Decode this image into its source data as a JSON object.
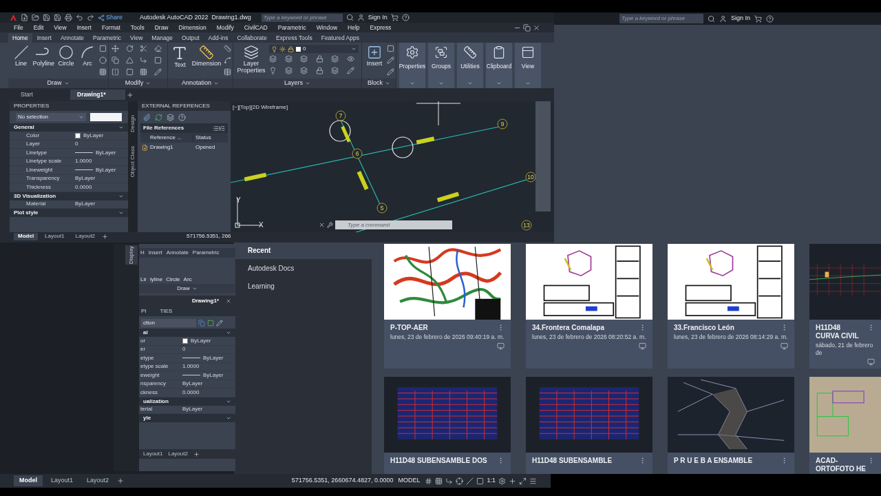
{
  "back_window": {
    "search": {
      "placeholder": "Type a keyword or phrase"
    },
    "sign_in": "Sign In",
    "nav": [
      {
        "label": "Recent",
        "selected": true
      },
      {
        "label": "Autodesk Docs",
        "selected": false
      },
      {
        "label": "Learning",
        "selected": false
      }
    ],
    "files": [
      {
        "name": "P-TOP-AER",
        "date": "lunes, 23 de febrero de 2026 09:40:19 a. m.",
        "kind": "map"
      },
      {
        "name": "34.Frontera Comalapa",
        "date": "lunes, 23 de febrero de 2026 08:20:52 a. m.",
        "kind": "plan"
      },
      {
        "name": "33.Francisco León",
        "date": "lunes, 23 de febrero de 2026 08:14:29 a. m.",
        "kind": "plan"
      },
      {
        "name": "H11D48 CURVA CIVIL",
        "date": "sábado, 21 de febrero de",
        "kind": "profile"
      },
      {
        "name": "H11D48 SUBENSAMBLE DOS",
        "kind": "table"
      },
      {
        "name": "H11D48 SUBENSAMBLE",
        "kind": "table"
      },
      {
        "name": "P R U E B A ENSAMBLE",
        "kind": "mesh"
      },
      {
        "name": "ACAD-ORTOFOTO HE",
        "kind": "aerial"
      }
    ],
    "status_bar": {
      "layout_tabs": [
        {
          "label": "Model",
          "selected": true
        },
        {
          "label": "Layout1",
          "selected": false
        },
        {
          "label": "Layout2",
          "selected": false
        }
      ],
      "coordinates": "571756.5351, 2660674.4827, 0.0000",
      "space": "MODEL",
      "scale": "1:1"
    }
  },
  "ghost_window": {
    "side_tab": "Display",
    "tabs": [
      "H",
      "Insert",
      "Annotate",
      "Parametric"
    ],
    "tools": [
      "Lir",
      "lyline",
      "Circle",
      "Arc"
    ],
    "panel": "Draw",
    "doc_tab": "Drawing1*",
    "palette_title": [
      "PI",
      "TIES"
    ],
    "selection": "ction",
    "sections": [
      {
        "title": "al",
        "rows": [
          {
            "name": "or",
            "value": "ByLayer",
            "kind": "color"
          },
          {
            "name": "er",
            "value": "0",
            "kind": "plain"
          },
          {
            "name": "etype",
            "value": "ByLayer",
            "kind": "line"
          },
          {
            "name": "etype scale",
            "value": "1.0000",
            "kind": "plain"
          },
          {
            "name": "eweight",
            "value": "ByLayer",
            "kind": "line"
          },
          {
            "name": "nsparency",
            "value": "ByLayer",
            "kind": "plain"
          },
          {
            "name": "ckness",
            "value": "0.0000",
            "kind": "plain"
          }
        ]
      },
      {
        "title": "ualization",
        "rows": [
          {
            "name": "terial",
            "value": "ByLayer",
            "kind": "plain"
          }
        ]
      },
      {
        "title": "yle"
      }
    ],
    "layout_tabs": [
      "Layout1",
      "Layout2"
    ]
  },
  "app_window": {
    "title": "Autodesk AutoCAD 2022",
    "file_name": "Drawing1.dwg",
    "share": "Share",
    "search": {
      "placeholder": "Type a keyword or phrase"
    },
    "sign_in": "Sign In",
    "menu": [
      "File",
      "Edit",
      "View",
      "Insert",
      "Format",
      "Tools",
      "Draw",
      "Dimension",
      "Modify",
      "CivilCAD",
      "Parametric",
      "Window",
      "Help",
      "Express"
    ],
    "ribbon_tabs": [
      {
        "label": "Home",
        "selected": true
      },
      {
        "label": "Insert",
        "selected": false
      },
      {
        "label": "Annotate",
        "selected": false
      },
      {
        "label": "Parametric",
        "selected": false
      },
      {
        "label": "View",
        "selected": false
      },
      {
        "label": "Manage",
        "selected": false
      },
      {
        "label": "Output",
        "selected": false
      },
      {
        "label": "Add-ins",
        "selected": false
      },
      {
        "label": "Collaborate",
        "selected": false
      },
      {
        "label": "Express Tools",
        "selected": false
      },
      {
        "label": "Featured Apps",
        "selected": false
      }
    ],
    "panels": [
      {
        "title": "Draw",
        "kind": "draw",
        "tools": [
          "Line",
          "Polyline",
          "Circle",
          "Arc"
        ]
      },
      {
        "title": "Modify",
        "kind": "modify"
      },
      {
        "title": "Annotation",
        "kind": "annotation",
        "tools": [
          "Text",
          "Dimension"
        ]
      },
      {
        "title": "Layers",
        "kind": "layers",
        "tools": [
          "Layer Properties"
        ],
        "layer": "0"
      },
      {
        "title": "Block",
        "kind": "block",
        "tools": [
          "Insert"
        ]
      }
    ],
    "collapsed_panels": [
      "Properties",
      "Groups",
      "Utilities",
      "Clipboard",
      "View"
    ],
    "doc_tabs": [
      {
        "label": "Start",
        "selected": false
      },
      {
        "label": "Drawing1*",
        "selected": true
      }
    ],
    "properties": {
      "title": "PROPERTIES",
      "selection": "No selection",
      "sections": [
        {
          "title": "General",
          "rows": [
            {
              "name": "Color",
              "value": "ByLayer",
              "kind": "color"
            },
            {
              "name": "Layer",
              "value": "0",
              "kind": "plain"
            },
            {
              "name": "Linetype",
              "value": "ByLayer",
              "kind": "line"
            },
            {
              "name": "Linetype scale",
              "value": "1.0000",
              "kind": "plain"
            },
            {
              "name": "Lineweight",
              "value": "ByLayer",
              "kind": "line"
            },
            {
              "name": "Transparency",
              "value": "ByLayer",
              "kind": "plain"
            },
            {
              "name": "Thickness",
              "value": "0.0000",
              "kind": "plain"
            }
          ]
        },
        {
          "title": "3D Visualization",
          "rows": [
            {
              "name": "Material",
              "value": "ByLayer",
              "kind": "plain"
            }
          ]
        },
        {
          "title": "Plot style"
        }
      ]
    },
    "side_tabs": [
      "Design",
      "Object Class"
    ],
    "xref": {
      "title": "EXTERNAL REFERENCES",
      "section": "File References",
      "columns": [
        "Reference ...",
        "Status"
      ],
      "rows": [
        {
          "name": "Drawing1",
          "status": "Opened"
        }
      ]
    },
    "viewport": {
      "label": "[−][Top][2D Wireframe]",
      "nodes": [
        "7",
        "6",
        "9",
        "10",
        "5",
        "13"
      ],
      "axis_labels": [
        "Y",
        "X"
      ],
      "command": {
        "placeholder": "Type a command"
      }
    },
    "layout_tabs": [
      {
        "label": "Model",
        "selected": true
      },
      {
        "label": "Layout1",
        "selected": false
      },
      {
        "label": "Layout2",
        "selected": false
      }
    ],
    "coordinates": "571756.5351, 266"
  }
}
